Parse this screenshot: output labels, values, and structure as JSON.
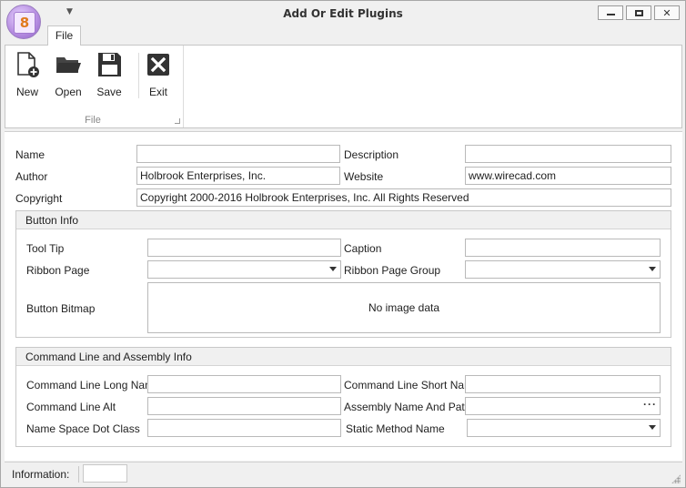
{
  "window": {
    "title": "Add Or Edit Plugins"
  },
  "tabs": [
    {
      "label": "File"
    }
  ],
  "ribbon": {
    "group_caption": "File",
    "buttons": [
      {
        "label": "New",
        "icon": "new-document-icon"
      },
      {
        "label": "Open",
        "icon": "folder-open-icon"
      },
      {
        "label": "Save",
        "icon": "floppy-disk-icon"
      },
      {
        "label": "Exit",
        "icon": "exit-x-icon"
      }
    ]
  },
  "general": {
    "name_label": "Name",
    "name_value": "",
    "description_label": "Description",
    "description_value": "",
    "author_label": "Author",
    "author_value": "Holbrook Enterprises, Inc.",
    "website_label": "Website",
    "website_value": "www.wirecad.com",
    "copyright_label": "Copyright",
    "copyright_value": "Copyright 2000-2016 Holbrook Enterprises, Inc. All Rights Reserved"
  },
  "button_info": {
    "header": "Button Info",
    "tooltip_label": "Tool Tip",
    "tooltip_value": "",
    "caption_label": "Caption",
    "caption_value": "",
    "ribbon_page_label": "Ribbon Page",
    "ribbon_page_value": "",
    "ribbon_page_group_label": "Ribbon Page Group",
    "ribbon_page_group_value": "",
    "bitmap_label": "Button Bitmap",
    "bitmap_empty_text": "No image data"
  },
  "command_info": {
    "header": "Command Line and Assembly Info",
    "long_name_label": "Command Line Long Name",
    "long_name_value": "",
    "short_name_label": "Command Line Short Name",
    "short_name_value": "",
    "alt_label": "Command Line Alt",
    "alt_value": "",
    "assembly_label": "Assembly Name And Path",
    "assembly_value": "",
    "assembly_browse": "···",
    "namespace_label": "Name Space Dot Class",
    "namespace_value": "",
    "static_method_label": "Static Method Name",
    "static_method_value": ""
  },
  "status": {
    "info_label": "Information:",
    "info_value": ""
  },
  "colors": {
    "accent_logo": "#b48be0",
    "logo_digit": "#e07a1e",
    "exit_icon": "#333333"
  }
}
